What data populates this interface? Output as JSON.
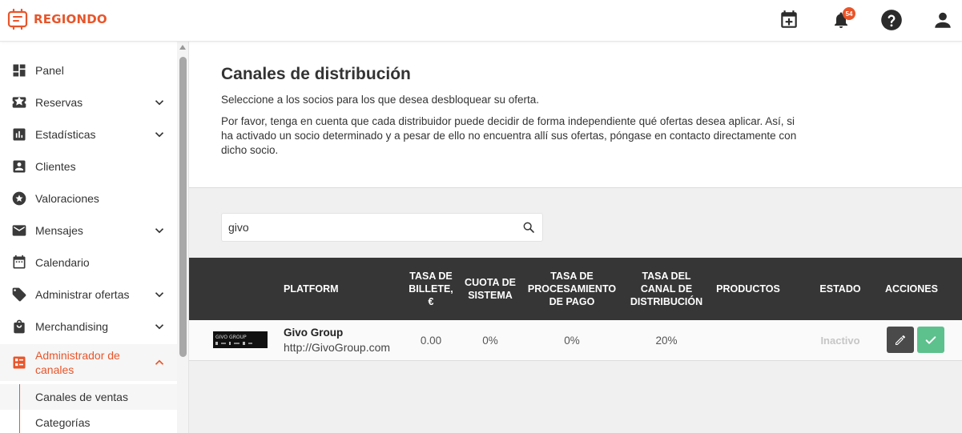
{
  "app": {
    "brand": "REGIONDO",
    "notification_count": "54"
  },
  "sidebar": {
    "items": [
      {
        "label": "Panel"
      },
      {
        "label": "Reservas"
      },
      {
        "label": "Estadísticas"
      },
      {
        "label": "Clientes"
      },
      {
        "label": "Valoraciones"
      },
      {
        "label": "Mensajes"
      },
      {
        "label": "Calendario"
      },
      {
        "label": "Administrar ofertas"
      },
      {
        "label": "Merchandising"
      },
      {
        "label": "Administrador de canales"
      }
    ],
    "subitems": [
      {
        "label": "Canales de ventas"
      },
      {
        "label": "Categorías"
      }
    ]
  },
  "page": {
    "title": "Canales de distribución",
    "intro": "Seleccione a los socios para los que desea desbloquear su oferta.",
    "note": "Por favor, tenga en cuenta que cada distribuidor puede decidir de forma independiente qué ofertas desea aplicar. Así, si ha activado un socio determinado y a pesar de ello no encuentra allí sus ofertas, póngase en contacto directamente con dicho socio."
  },
  "search": {
    "value": "givo"
  },
  "table": {
    "headers": {
      "platform": "PLATFORM",
      "ticket_fee": "TASA DE BILLETE, €",
      "system_fee": "CUOTA DE SISTEMA",
      "payment_fee": "TASA DE PROCESAMIENTO DE PAGO",
      "channel_fee": "TASA DEL CANAL DE DISTRIBUCIÓN",
      "products": "PRODUCTOS",
      "status": "ESTADO",
      "actions": "ACCIONES"
    },
    "rows": [
      {
        "logo_text": "GIVO GROUP",
        "name": "Givo Group",
        "url": "http://GivoGroup.com",
        "ticket_fee": "0.00",
        "system_fee": "0%",
        "payment_fee": "0%",
        "channel_fee": "20%",
        "products": "",
        "status": "Inactivo"
      }
    ]
  },
  "colors": {
    "accent": "#e8552a",
    "header_bg": "#363636",
    "success": "#5cc18c"
  }
}
